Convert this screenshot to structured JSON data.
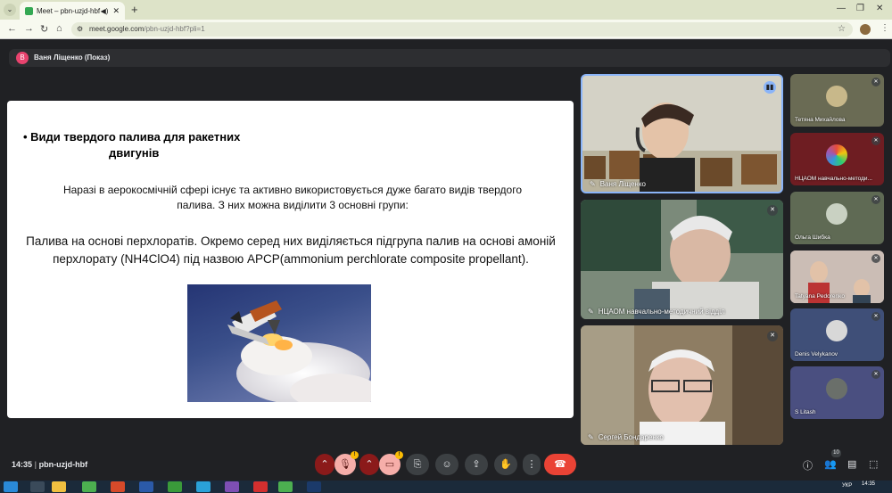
{
  "browser": {
    "tab_title": "Meet – pbn-uzjd-hbf",
    "url_domain": "meet.google.com",
    "url_path": "/pbn-uzjd-hbf?pli=1",
    "new_tab_label": "+"
  },
  "presenter": {
    "avatar_letter": "В",
    "label": "Ваня Ліщенко (Показ)"
  },
  "slide": {
    "title_line1": "• Види твердого палива для ракетних",
    "title_line2": "двигунів",
    "paragraph1": "Наразі в аерокосмічній сфері існує та активно використовується дуже багато видів твердого палива. З них можна виділити 3 основні групи:",
    "paragraph2": "Палива на основі перхлоратів. Окремо серед них виділяється підгрупа палив на основі амоній перхлорату (NH4ClO4) під назвою APCP(ammonium perchlorate composite propellant)."
  },
  "main_tiles": [
    {
      "name": "Ваня Ліщенко",
      "state": "speaking"
    },
    {
      "name": "НЦАОМ навчально-методичний відділ",
      "state": "muted"
    },
    {
      "name": "Сергей Бондаренко",
      "state": "muted"
    }
  ],
  "side_tiles": [
    {
      "name": "Тетяна Михайлова"
    },
    {
      "name": "НЦАОМ навчально-методи..."
    },
    {
      "name": "Ольга Шибка"
    },
    {
      "name": "Tatyana Pedorenko"
    },
    {
      "name": "Denis Velykanov"
    },
    {
      "name": "S Litash"
    }
  ],
  "meeting": {
    "time": "14:35",
    "separator": "|",
    "code": "pbn-uzjd-hbf",
    "participant_count": "10"
  },
  "taskbar": {
    "clock": "14:35",
    "lang": "УКР"
  }
}
